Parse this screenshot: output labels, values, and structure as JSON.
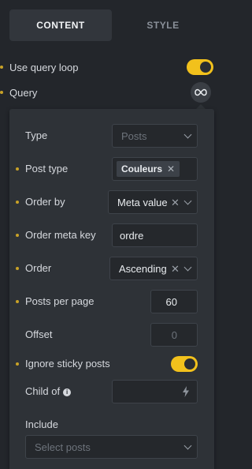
{
  "tabs": [
    {
      "label": "CONTENT",
      "active": true
    },
    {
      "label": "STYLE",
      "active": false
    }
  ],
  "top": {
    "use_query_loop_label": "Use query loop",
    "use_query_loop_on": true,
    "query_label": "Query",
    "query_icon": "infinity-icon"
  },
  "panel": {
    "type": {
      "label": "Type",
      "value": "Posts"
    },
    "post_type": {
      "label": "Post type",
      "tag": "Couleurs"
    },
    "order_by": {
      "label": "Order by",
      "value": "Meta value"
    },
    "order_meta_key": {
      "label": "Order meta key",
      "value": "ordre"
    },
    "order": {
      "label": "Order",
      "value": "Ascending"
    },
    "posts_per_page": {
      "label": "Posts per page",
      "value": "60"
    },
    "offset": {
      "label": "Offset",
      "placeholder": "0"
    },
    "ignore_sticky": {
      "label": "Ignore sticky posts",
      "on": true
    },
    "child_of": {
      "label": "Child of",
      "icon": "bolt-icon"
    },
    "include": {
      "label": "Include",
      "placeholder": "Select posts"
    }
  },
  "colors": {
    "accent": "#f2c11c",
    "modified_dot": "#c9a227",
    "background": "#23262b",
    "panel": "#2e3237"
  }
}
